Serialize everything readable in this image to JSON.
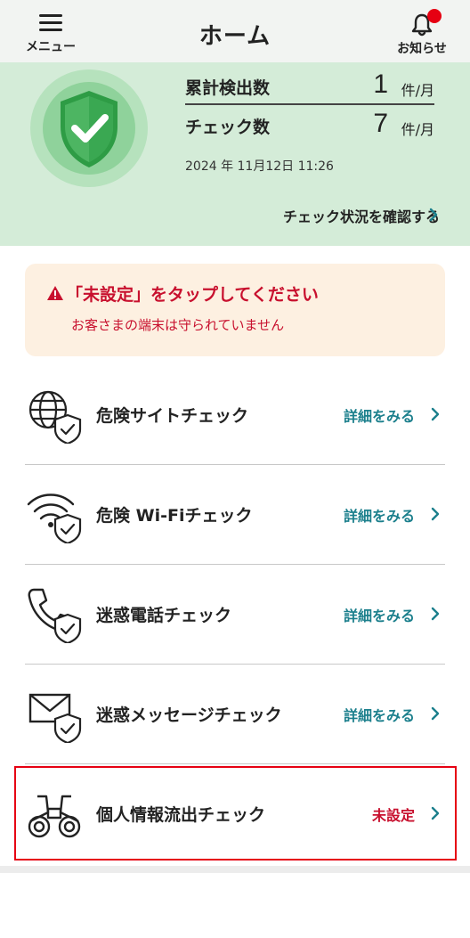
{
  "header": {
    "menu_label": "メニュー",
    "title": "ホーム",
    "notifications_label": "お知らせ",
    "notification_dot_color": "#e60012"
  },
  "status": {
    "shield_icon": "shield-check-icon",
    "total_detections_label": "累計検出数",
    "total_detections_value": "1",
    "total_detections_unit": "件/月",
    "checks_label": "チェック数",
    "checks_value": "7",
    "checks_unit": "件/月",
    "timestamp": "2024 年 11月12日 11:26",
    "confirm_link": "チェック状況を確認する",
    "panel_color": "#d4ecd8"
  },
  "warning": {
    "icon": "warning-icon",
    "title": "「未設定」をタップしてください",
    "text": "お客さまの端末は守られていません",
    "color": "#c8102e",
    "background": "#fdf0e1"
  },
  "checks": [
    {
      "icon": "globe-shield-icon",
      "label": "危険サイトチェック",
      "action": "詳細をみる"
    },
    {
      "icon": "wifi-shield-icon",
      "label": "危険 Wi-Fiチェック",
      "action": "詳細をみる"
    },
    {
      "icon": "phone-shield-icon",
      "label": "迷惑電話チェック",
      "action": "詳細をみる"
    },
    {
      "icon": "envelope-shield-icon",
      "label": "迷惑メッセージチェック",
      "action": "詳細をみる"
    },
    {
      "icon": "binoculars-icon",
      "label": "個人情報流出チェック",
      "action": "未設定"
    }
  ],
  "colors": {
    "link_teal": "#1b7f8c",
    "alert_red": "#c8102e",
    "highlight_red": "#e60012"
  }
}
